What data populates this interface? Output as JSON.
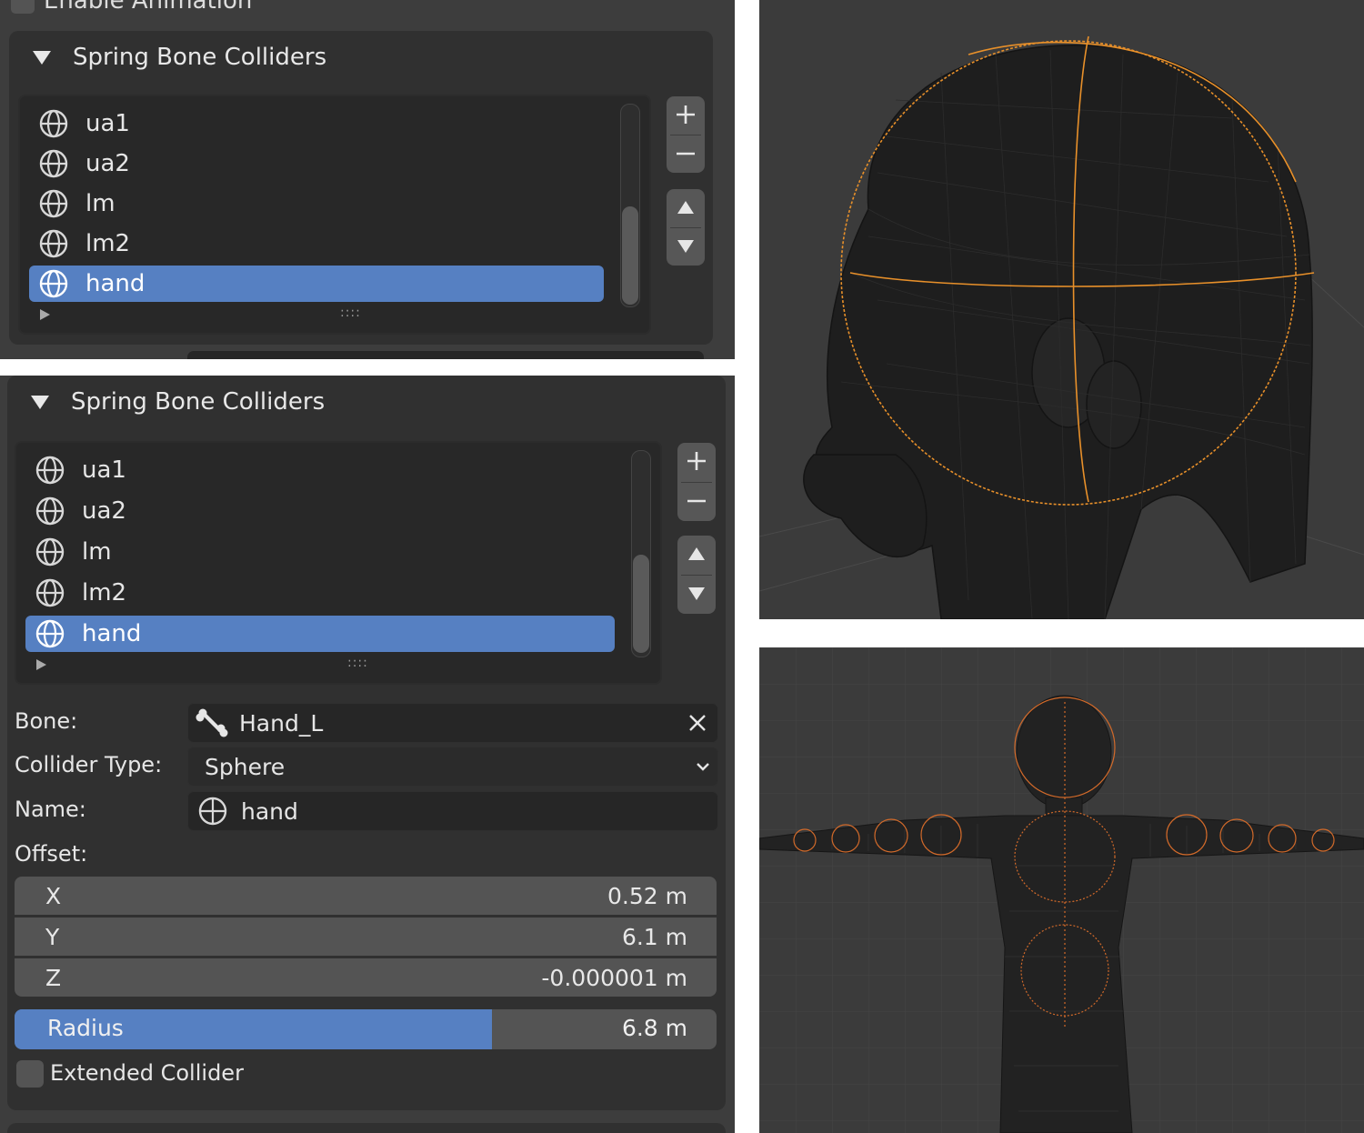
{
  "top_panel": {
    "partial_row_label": "Enable Animation",
    "section_title": "Spring Bone Colliders",
    "colliders": [
      {
        "label": "ua1",
        "selected": false
      },
      {
        "label": "ua2",
        "selected": false
      },
      {
        "label": "lm",
        "selected": false
      },
      {
        "label": "lm2",
        "selected": false
      },
      {
        "label": "hand",
        "selected": true
      }
    ],
    "grip": "::::"
  },
  "bottom_panel": {
    "section_title": "Spring Bone Colliders",
    "colliders": [
      {
        "label": "ua1",
        "selected": false
      },
      {
        "label": "ua2",
        "selected": false
      },
      {
        "label": "lm",
        "selected": false
      },
      {
        "label": "lm2",
        "selected": false
      },
      {
        "label": "hand",
        "selected": true
      }
    ],
    "grip": "::::",
    "bone": {
      "label": "Bone:",
      "value": "Hand_L"
    },
    "collider_type": {
      "label": "Collider Type:",
      "value": "Sphere"
    },
    "name": {
      "label": "Name:",
      "value": "hand"
    },
    "offset": {
      "label": "Offset:",
      "x": {
        "axis": "X",
        "value": "0.52 m"
      },
      "y": {
        "axis": "Y",
        "value": "6.1 m"
      },
      "z": {
        "axis": "Z",
        "value": "-0.000001 m"
      }
    },
    "radius": {
      "label": "Radius",
      "value": "6.8 m",
      "fill_fraction": 0.68
    },
    "extended_collider": {
      "label": "Extended Collider",
      "checked": false
    }
  },
  "colors": {
    "panel_bg": "#3d3d3d",
    "selection_blue": "#5680c2",
    "viewport_bg": "#3b3b3b",
    "collider_orange": "#e8902a"
  },
  "icons": {
    "collider": "globe-icon",
    "bone": "bone-icon",
    "clear": "close-icon",
    "dropdown": "chevron-down-icon"
  }
}
